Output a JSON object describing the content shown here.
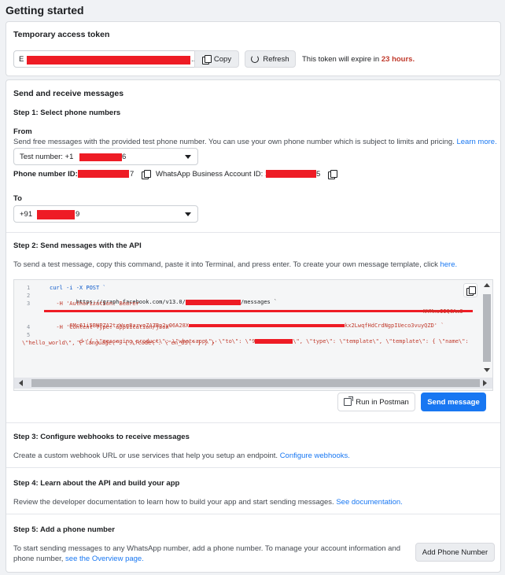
{
  "page": {
    "title": "Getting started"
  },
  "token": {
    "heading": "Temporary access token",
    "value_prefix": "E",
    "value_suffix": "...",
    "copy_label": "Copy",
    "refresh_label": "Refresh",
    "expire_text": "This token will expire in ",
    "expire_hours": "23 hours."
  },
  "send": {
    "heading": "Send and receive messages",
    "step1": {
      "heading": "Step 1: Select phone numbers",
      "from_label": "From",
      "from_desc": "Send free messages with the provided test phone number. You can use your own phone number which is subject to limits and pricing.",
      "learn_more": "Learn more.",
      "test_number_prefix": "Test number: +1",
      "test_number_suffix": "6",
      "phone_id_label": "Phone number ID: 1",
      "phone_id_suffix": "7",
      "waba_label": "WhatsApp Business Account ID: 1",
      "waba_suffix": "5",
      "to_label": "To",
      "to_prefix": "+91",
      "to_suffix": "9"
    },
    "step2": {
      "heading": "Step 2: Send messages with the API",
      "desc": "To send a test message, copy this command, paste it into Terminal, and press enter. To create your own message template, click ",
      "desc_link": "here.",
      "code": {
        "line_numbers": [
          "1",
          "2",
          "3",
          "",
          "4",
          "5",
          ""
        ],
        "l1": "curl -i -X POST `",
        "l2a": "  https://graph.facebook.com/v13.0/",
        "l2b": "/messages `",
        "l3": "  -H 'Authorization: Bearer",
        "l3b_end": "NYMnsIIQCAm3",
        "l3c": "6Mc61i5BNPZA2tzWsg8azvoZAZBp2yO6A28X",
        "l3c_end": "kx2LwqfHdCrdNgpIUeco3vuyQZD' `",
        "l4": "  -H 'Content-Type: application/json' `",
        "l5a": "  -d '{ \\\"messaging_product\\\": \\\"whatsapp\\\", \\\"to\\\": \\\"9",
        "l5b": "\\\", \\\"type\\\": \\\"template\\\", \\\"template\\\": { \\\"name\\\":",
        "l6": "\\\"hello_world\\\", \\\"language\\\": { \\\"code\\\": \\\"en_US\\\" } } }'"
      },
      "postman_label": "Run in Postman",
      "send_label": "Send message"
    },
    "step3": {
      "heading": "Step 3: Configure webhooks to receive messages",
      "desc": "Create a custom webhook URL or use services that help you setup an endpoint. ",
      "link": "Configure webhooks."
    },
    "step4": {
      "heading": "Step 4: Learn about the API and build your app",
      "desc": "Review the developer documentation to learn how to build your app and start sending messages. ",
      "link": "See documentation."
    },
    "step5": {
      "heading": "Step 5: Add a phone number",
      "desc1": "To start sending messages to any WhatsApp number, add a phone number. To manage your account information and",
      "desc2": "phone number, ",
      "link": "see the Overview page.",
      "button_label": "Add Phone Number"
    }
  },
  "colors": {
    "accent": "#1877f2",
    "redaction": "#ee1c25",
    "expire": "#c0392b"
  }
}
